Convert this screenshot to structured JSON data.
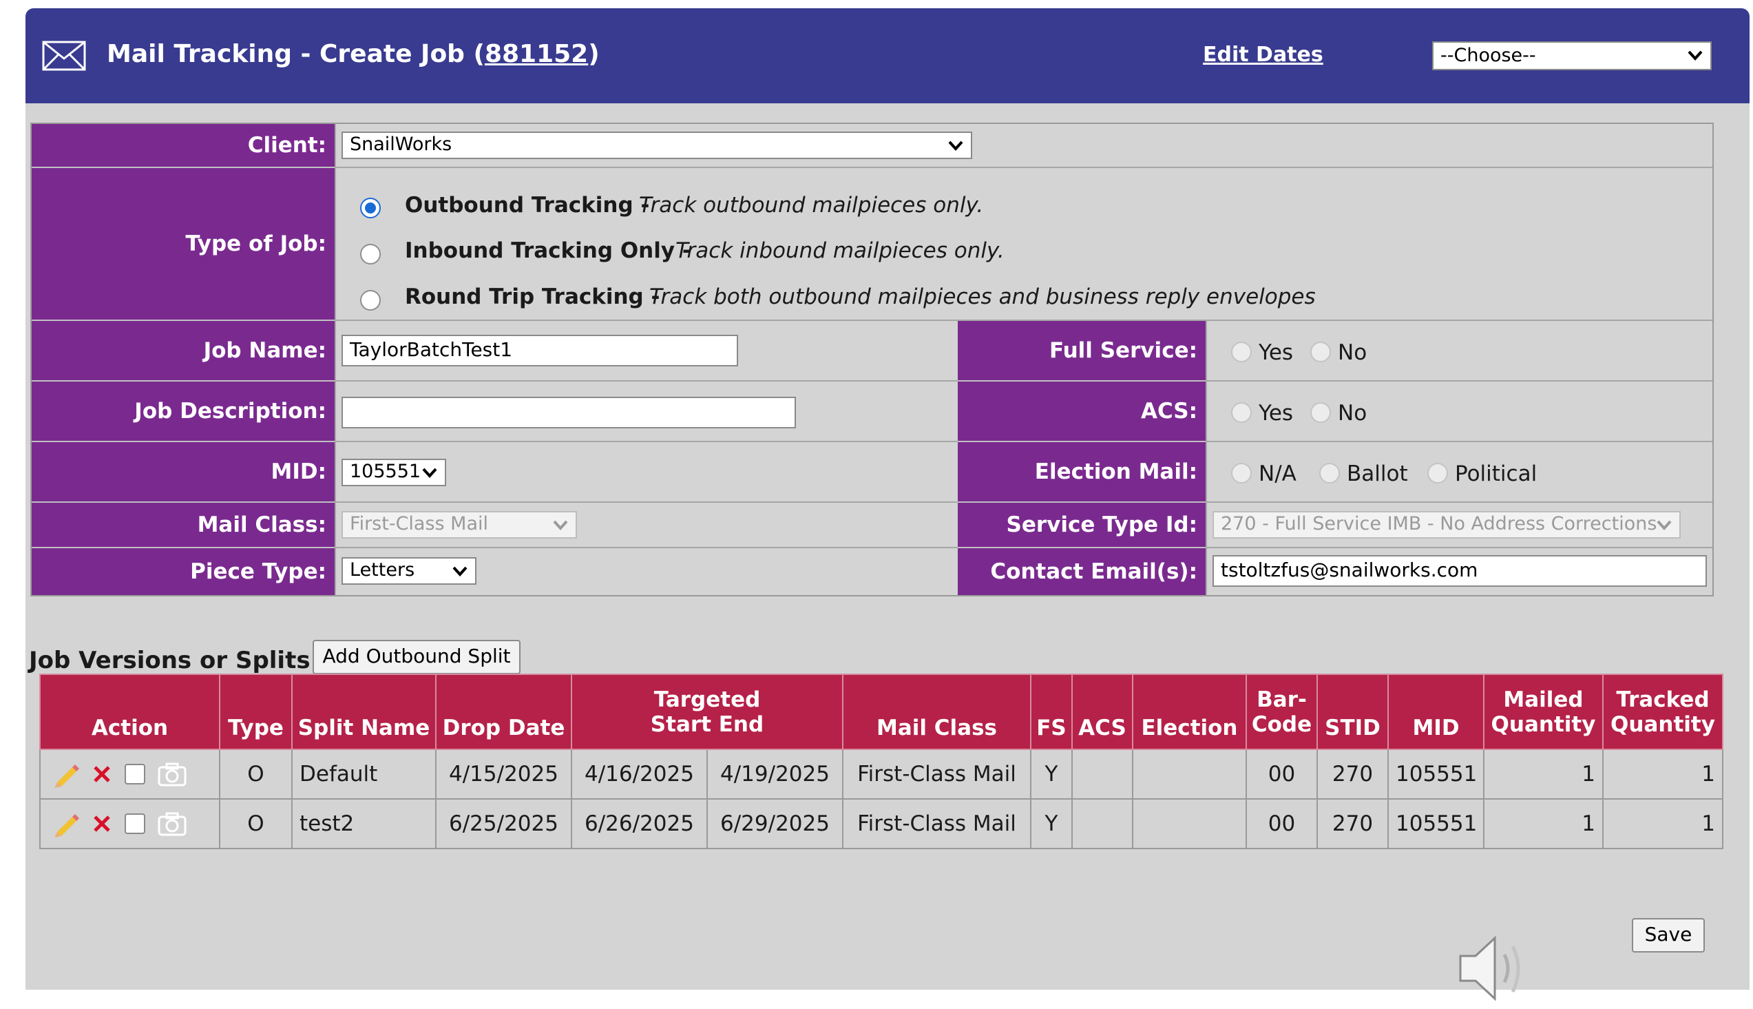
{
  "header": {
    "title_prefix": "Mail Tracking - Create Job (",
    "job_number": "881152",
    "title_suffix": ")",
    "edit_dates": "Edit Dates",
    "choose_value": "--Choose--"
  },
  "form": {
    "client_label": "Client:",
    "client_value": "SnailWorks",
    "type_label": "Type of Job:",
    "job_types": [
      {
        "name": "Outbound Tracking -",
        "desc": "Track outbound mailpieces only.",
        "checked": true
      },
      {
        "name": "Inbound Tracking Only -",
        "desc": "Track inbound mailpieces only.",
        "checked": false
      },
      {
        "name": "Round Trip Tracking -",
        "desc": "Track both outbound mailpieces and business reply envelopes",
        "checked": false
      }
    ],
    "job_name_label": "Job Name:",
    "job_name_value": "TaylorBatchTest1",
    "job_desc_label": "Job Description:",
    "job_desc_value": "",
    "mid_label": "MID:",
    "mid_value": "105551",
    "mail_class_label": "Mail Class:",
    "mail_class_value": "First-Class Mail",
    "piece_type_label": "Piece Type:",
    "piece_type_value": "Letters",
    "full_service_label": "Full Service:",
    "acs_label": "ACS:",
    "yes": "Yes",
    "no": "No",
    "election_label": "Election Mail:",
    "election_options": [
      "N/A",
      "Ballot",
      "Political"
    ],
    "stid_label": "Service Type Id:",
    "stid_value": "270 - Full Service IMB - No Address Corrections",
    "contact_label": "Contact Email(s):",
    "contact_value": "tstoltzfus@snailworks.com"
  },
  "splits": {
    "label": "Job Versions or Splits:",
    "add_button": "Add Outbound Split",
    "headers": {
      "action": "Action",
      "type": "Type",
      "split_name": "Split Name",
      "drop_date": "Drop Date",
      "targeted": "Targeted",
      "start_end": "Start End",
      "mail_class": "Mail Class",
      "fs": "FS",
      "acs": "ACS",
      "election": "Election",
      "barcode": "Bar-Code",
      "stid": "STID",
      "mid": "MID",
      "mailed_qty": "Mailed Quantity",
      "tracked_qty": "Tracked Quantity"
    },
    "rows": [
      {
        "type": "O",
        "split_name": "Default",
        "drop_date": "4/15/2025",
        "start": "4/16/2025",
        "end": "4/19/2025",
        "mail_class": "First-Class Mail",
        "fs": "Y",
        "acs": "",
        "election": "",
        "barcode": "00",
        "stid": "270",
        "mid": "105551",
        "mailed": "1",
        "tracked": "1"
      },
      {
        "type": "O",
        "split_name": "test2",
        "drop_date": "6/25/2025",
        "start": "6/26/2025",
        "end": "6/29/2025",
        "mail_class": "First-Class Mail",
        "fs": "Y",
        "acs": "",
        "election": "",
        "barcode": "00",
        "stid": "270",
        "mid": "105551",
        "mailed": "1",
        "tracked": "1"
      }
    ]
  },
  "footer": {
    "save": "Save"
  },
  "colors": {
    "header": "#383b8f",
    "label_bg": "#7a2a8f",
    "table_header": "#b52148",
    "radio_checked": "#1b6bd6"
  }
}
